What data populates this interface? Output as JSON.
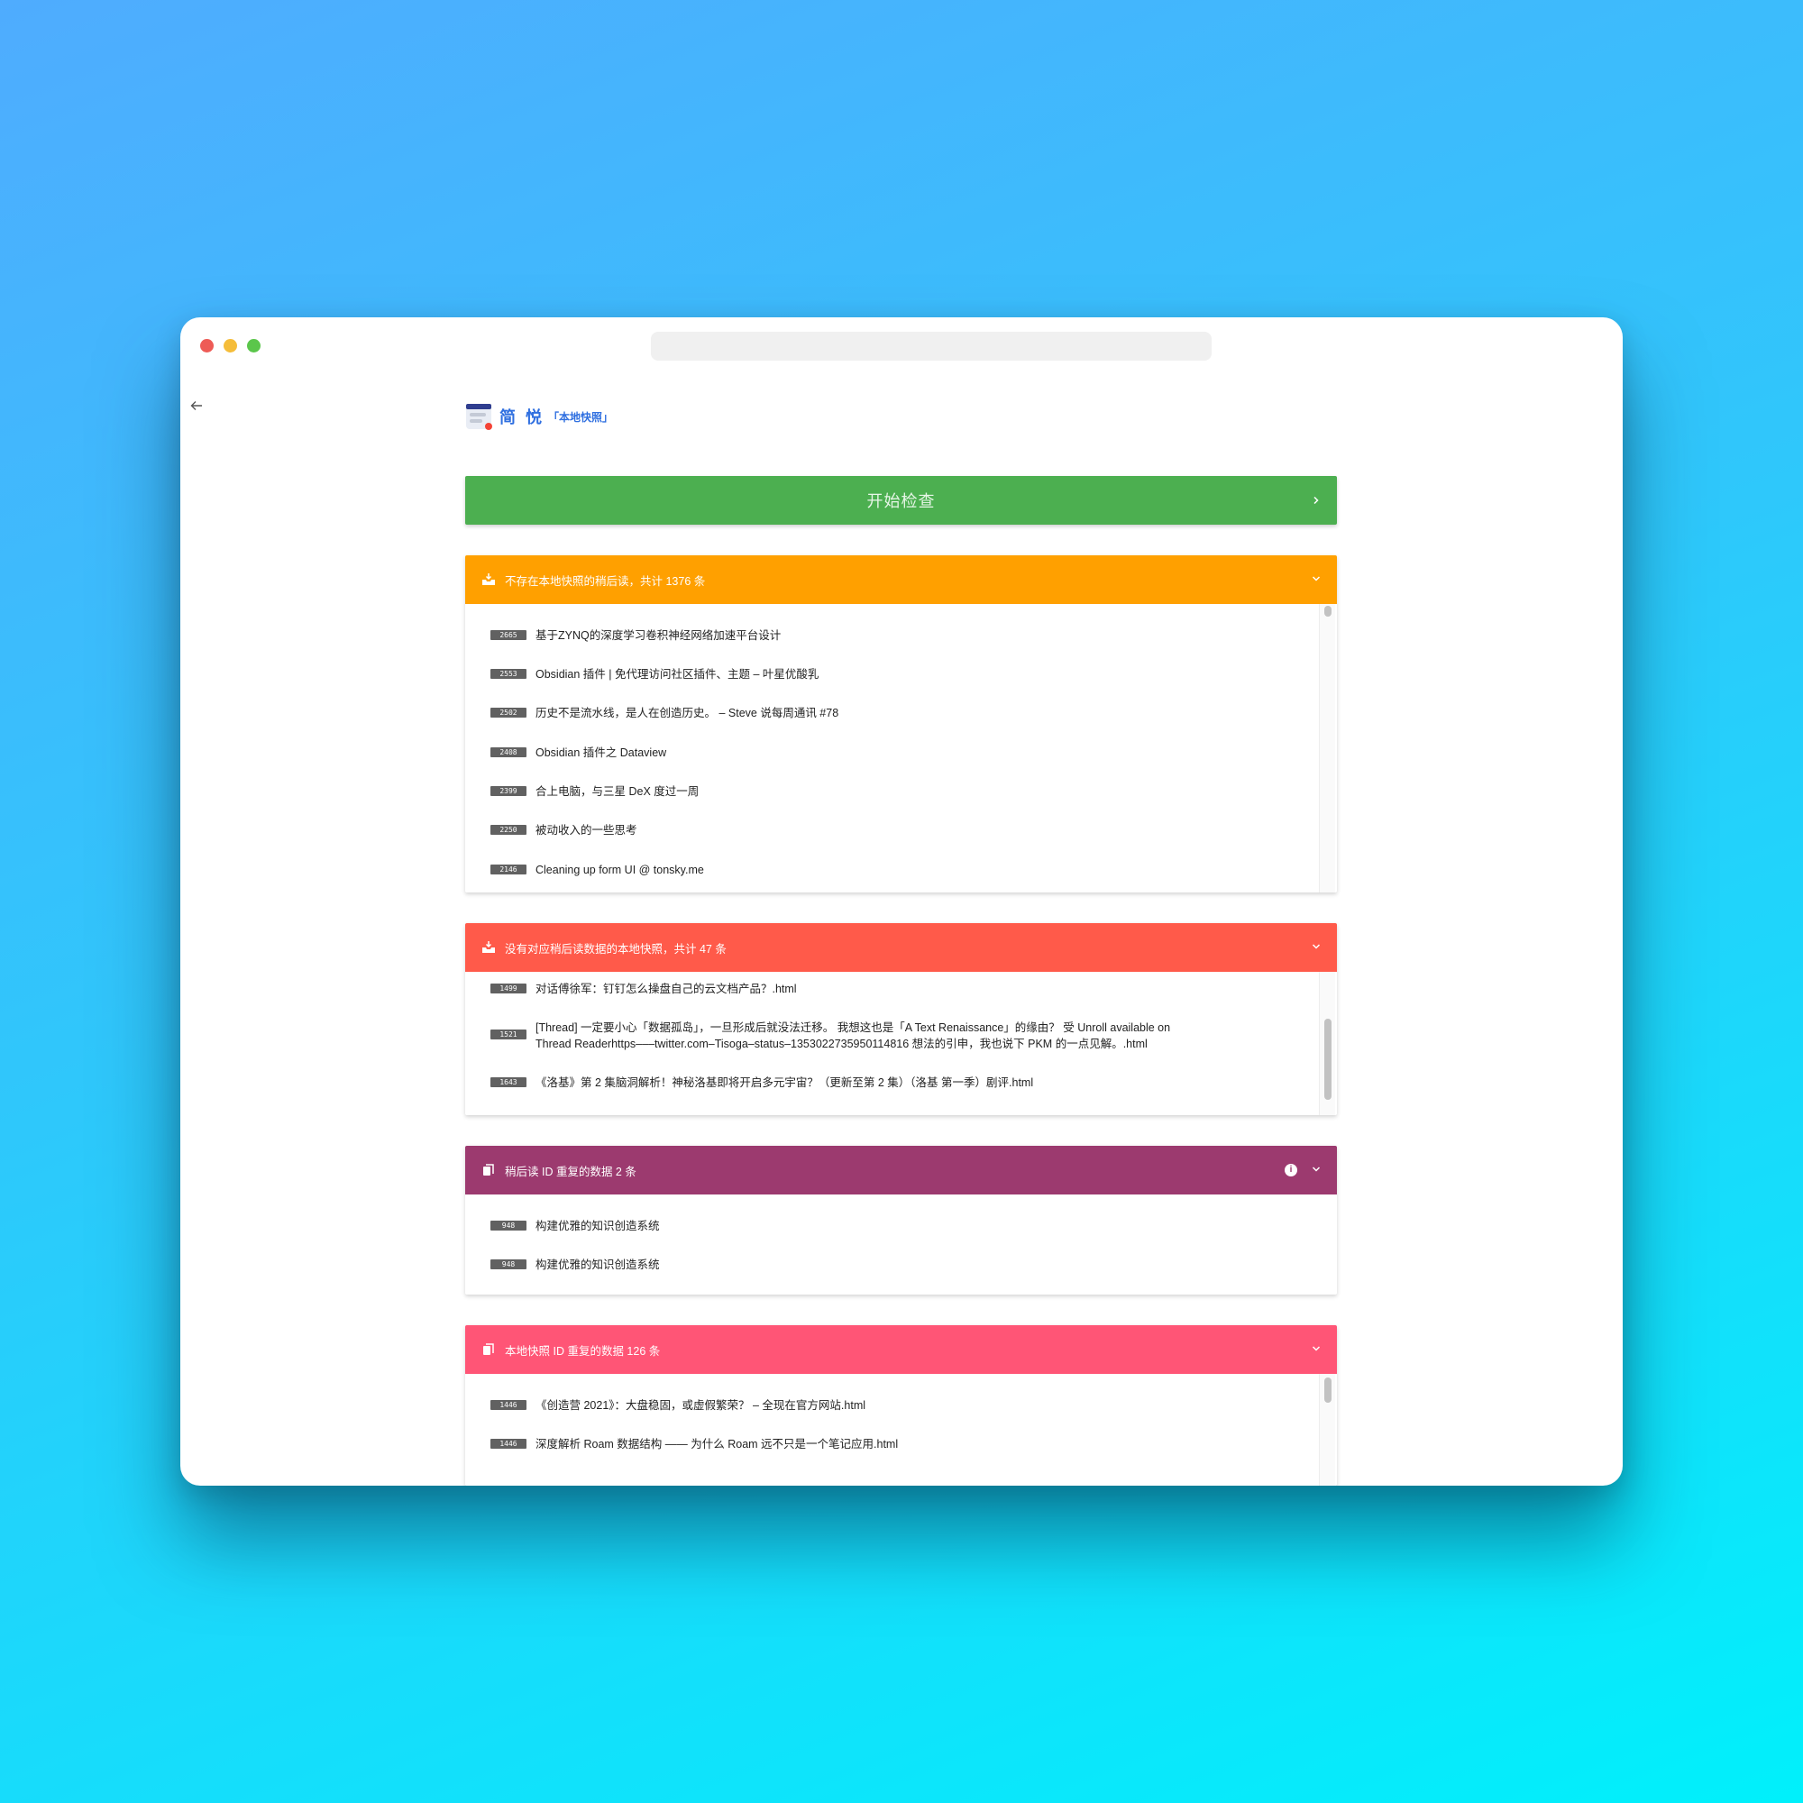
{
  "brand": {
    "name": "简 悦",
    "subtitle": "「本地快照」"
  },
  "start_button": {
    "label": "开始检查"
  },
  "panels": [
    {
      "id": "missing-snapshots",
      "color": "#ffa000",
      "icon": "inbox-download-icon",
      "title": "不存在本地快照的稍后读，共计 1376 条",
      "rows": [
        {
          "id": "2665",
          "text": "基于ZYNQ的深度学习卷积神经网络加速平台设计"
        },
        {
          "id": "2553",
          "text": "Obsidian 插件 | 免代理访问社区插件、主题 – 叶星优酸乳"
        },
        {
          "id": "2502",
          "text": "历史不是流水线，是人在创造历史。 – Steve 说每周通讯 #78"
        },
        {
          "id": "2408",
          "text": "Obsidian 插件之 Dataview"
        },
        {
          "id": "2399",
          "text": "合上电脑，与三星 DeX 度过一周"
        },
        {
          "id": "2250",
          "text": "被动收入的一些思考"
        },
        {
          "id": "2146",
          "text": "Cleaning up form UI @ tonsky.me"
        }
      ]
    },
    {
      "id": "orphan-snapshots",
      "color": "#ff5a4a",
      "icon": "inbox-download-icon",
      "title": "没有对应稍后读数据的本地快照，共计 47 条",
      "rows": [
        {
          "id": "1499",
          "text": "对话傅徐军：钉钉怎么操盘自己的云文档产品？.html"
        },
        {
          "id": "1521",
          "text": "[Thread] 一定要小心「数据孤岛」，一旦形成后就没法迁移。 我想这也是「A Text Renaissance」的缘由？ 受 Unroll available on",
          "text2": "Thread Readerhttps–––twitter.com–Tisoga–status–1353022735950114816 想法的引申，我也说下 PKM 的一点见解。.html"
        },
        {
          "id": "1643",
          "text": "《洛基》第 2 集脑洞解析！神秘洛基即将开启多元宇宙？（更新至第 2 集）（洛基 第一季）剧评.html"
        }
      ]
    },
    {
      "id": "duplicate-readlater",
      "color": "#9c3a6f",
      "icon": "copy-icon",
      "title": "稍后读 ID 重复的数据 2 条",
      "info": "i",
      "rows": [
        {
          "id": "948",
          "text": "构建优雅的知识创造系统"
        },
        {
          "id": "948",
          "text": "构建优雅的知识创造系统"
        }
      ]
    },
    {
      "id": "duplicate-snapshots",
      "color": "#ff5576",
      "icon": "copy-icon",
      "title": "本地快照 ID 重复的数据 126 条",
      "rows": [
        {
          "id": "1446",
          "text": "《创造营 2021》：大盘稳固，或虚假繁荣？ – 全现在官方网站.html"
        },
        {
          "id": "1446",
          "text": "深度解析 Roam 数据结构 —— 为什么 Roam 远不只是一个笔记应用.html"
        }
      ]
    }
  ]
}
